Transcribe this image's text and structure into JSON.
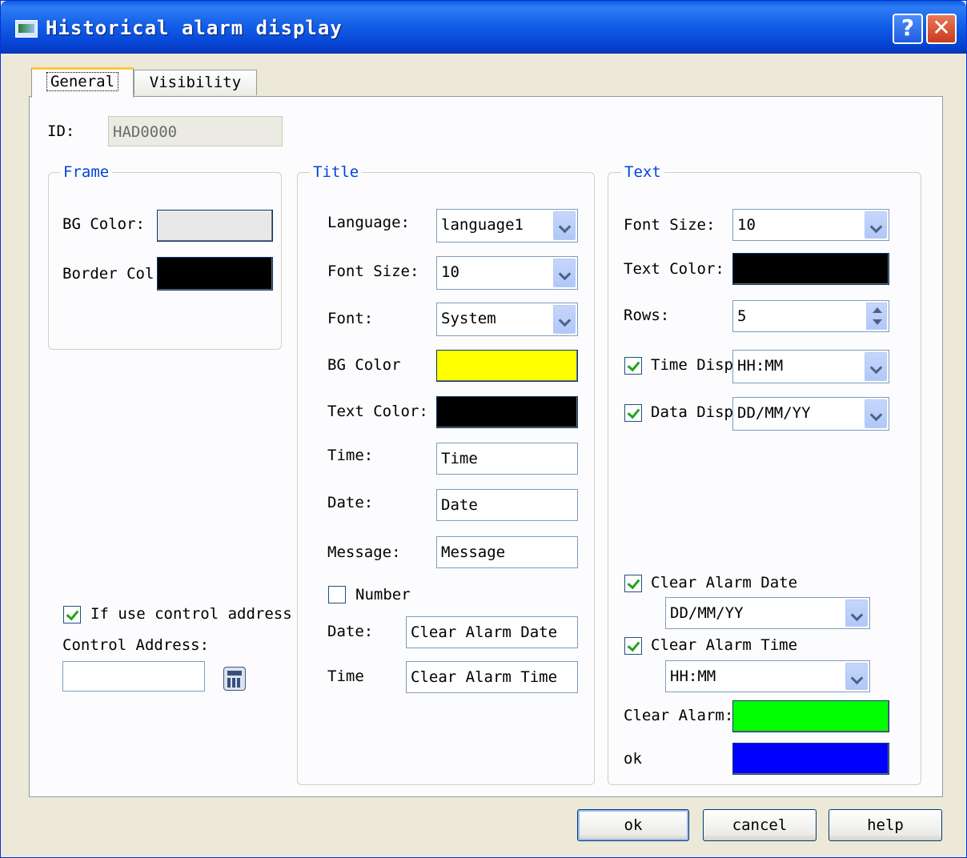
{
  "window": {
    "title": "Historical alarm display",
    "help_glyph": "?",
    "close_glyph": "✕"
  },
  "tabs": [
    "General",
    "Visibility"
  ],
  "general": {
    "id_label": "ID:",
    "id_value": "HAD0000",
    "frame": {
      "title": "Frame",
      "bg_color_label": "BG Color:",
      "bg_color": "#e8e8e8",
      "border_color_label": "Border Col",
      "border_color": "#000000"
    },
    "control": {
      "use_label": "If use control address",
      "use_checked": true,
      "address_label": "Control Address:",
      "address_value": ""
    },
    "title_group": {
      "title": "Title",
      "language_label": "Language:",
      "language_value": "language1",
      "font_size_label": "Font Size:",
      "font_size_value": "10",
      "font_label": "Font:",
      "font_value": "System",
      "bg_color_label": "BG Color",
      "bg_color": "#ffff00",
      "text_color_label": "Text Color:",
      "text_color": "#000000",
      "time_label": "Time:",
      "time_value": "Time",
      "date_label": "Date:",
      "date_value": "Date",
      "message_label": "Message:",
      "message_value": "Message",
      "number_label": "Number",
      "number_checked": false,
      "clear_date_label": "Date:",
      "clear_date_value": "Clear Alarm Date",
      "clear_time_label": "Time",
      "clear_time_value": "Clear Alarm Time"
    },
    "text_group": {
      "title": "Text",
      "font_size_label": "Font Size:",
      "font_size_value": "10",
      "text_color_label": "Text Color:",
      "text_color": "#000000",
      "rows_label": "Rows:",
      "rows_value": "5",
      "time_disp_label": "Time Disp",
      "time_disp_checked": true,
      "time_disp_value": "HH:MM",
      "data_disp_label": "Data Disp",
      "data_disp_checked": true,
      "data_disp_value": "DD/MM/YY",
      "clear_alarm_date_label": "Clear Alarm Date",
      "clear_alarm_date_checked": true,
      "clear_alarm_date_value": "DD/MM/YY",
      "clear_alarm_time_label": "Clear Alarm Time",
      "clear_alarm_time_checked": true,
      "clear_alarm_time_value": "HH:MM",
      "clear_alarm_label": "Clear Alarm:",
      "clear_alarm_color": "#00ff00",
      "ok_label": "ok",
      "ok_color": "#0000ff"
    }
  },
  "buttons": {
    "ok": "ok",
    "cancel": "cancel",
    "help": "help"
  }
}
